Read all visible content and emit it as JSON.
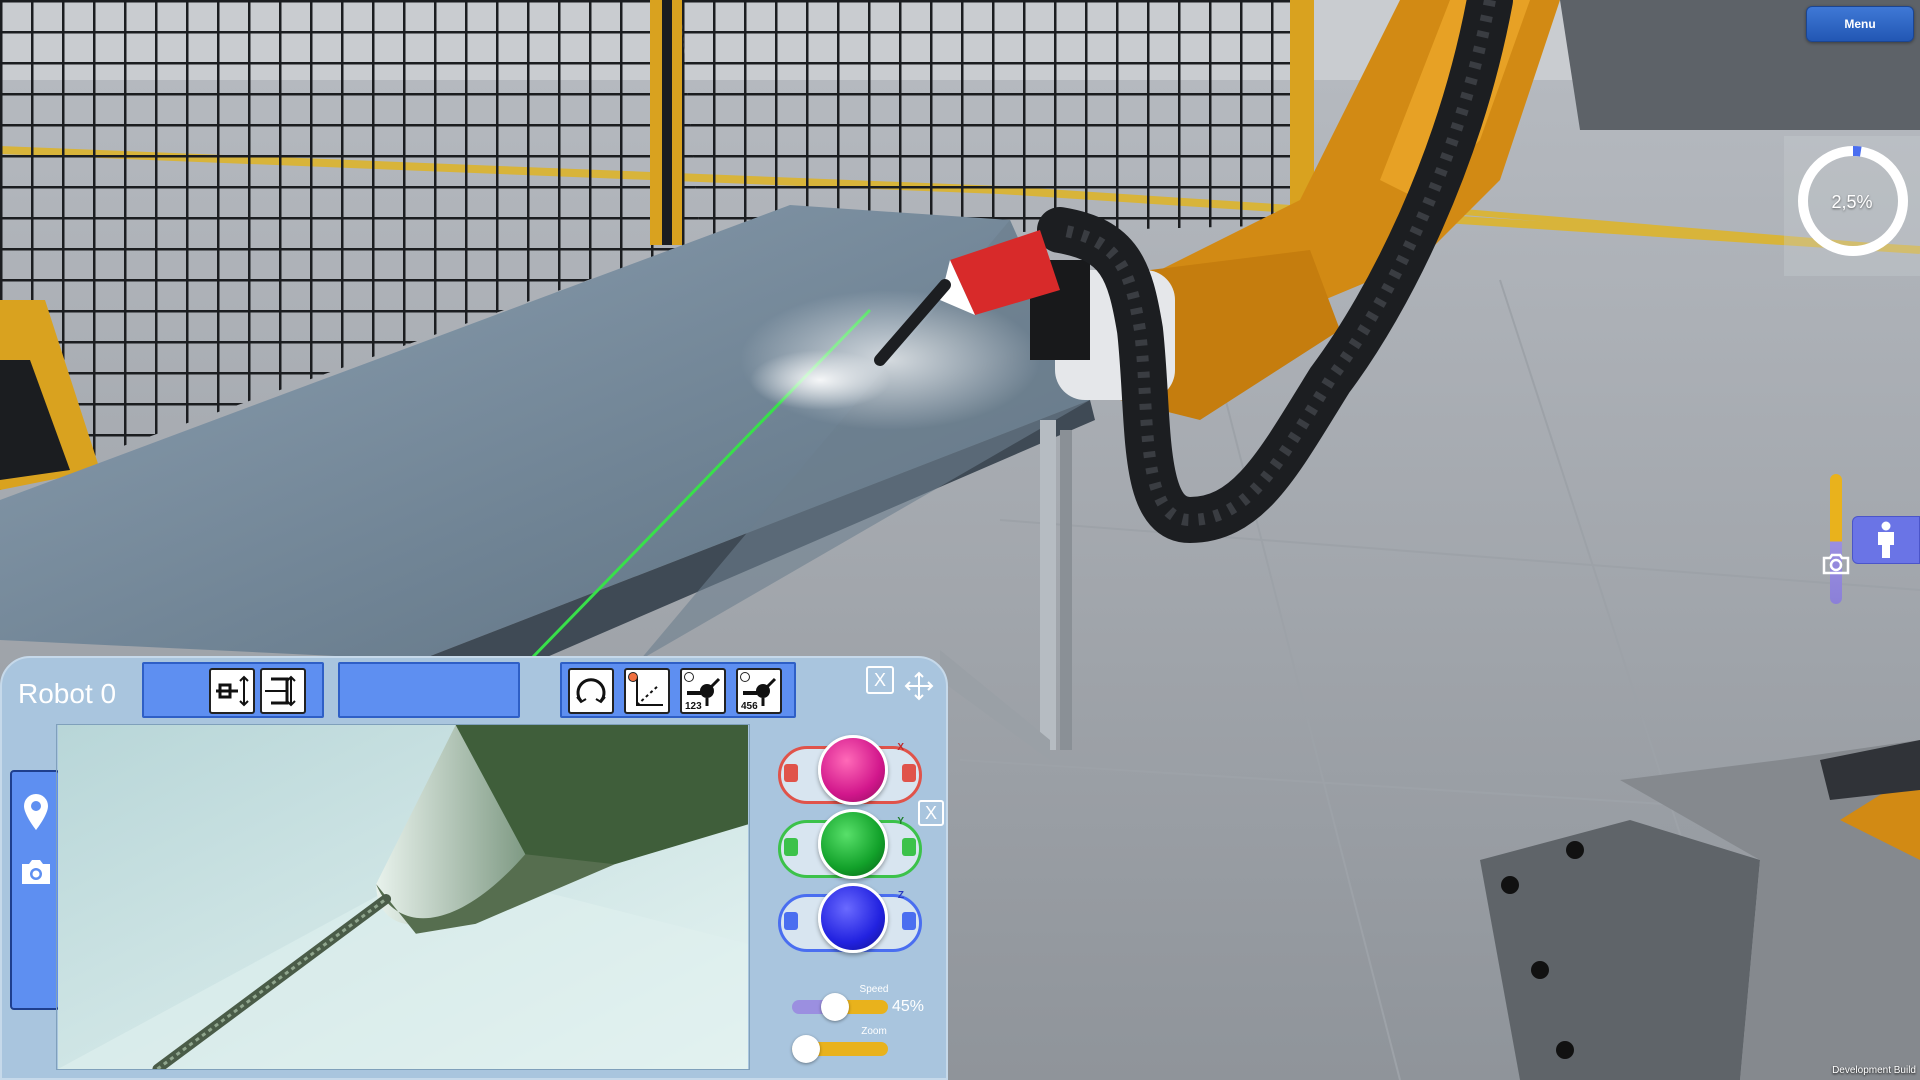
{
  "menu": {
    "label": "Menu"
  },
  "progress": {
    "value_text": "2,5%",
    "fraction": 0.025
  },
  "robot_panel": {
    "title": "Robot 0",
    "close_symbol": "X",
    "tool_buttons": [
      {
        "icon": "linear-jog-icon",
        "number": ""
      },
      {
        "icon": "frame-select-icon",
        "number": ""
      },
      {
        "icon": "rotate-icon",
        "number": ""
      },
      {
        "icon": "axis-icon",
        "number": ""
      },
      {
        "icon": "weld-point-icon",
        "number": "123"
      },
      {
        "icon": "weld-point-icon",
        "number": "456"
      }
    ],
    "jog": [
      {
        "axis": "X",
        "color": "#d2178c",
        "ring": "#e0534a"
      },
      {
        "axis": "Y",
        "color": "#12a12a",
        "ring": "#3cc24a"
      },
      {
        "axis": "Z",
        "color": "#2222e0",
        "ring": "#4a6ef0"
      }
    ],
    "speed": {
      "label": "Speed",
      "value_text": "45%",
      "fraction": 0.45
    },
    "zoom": {
      "label": "Zoom",
      "fraction": 0.0
    }
  },
  "footer": {
    "build_label": "Development Build"
  }
}
